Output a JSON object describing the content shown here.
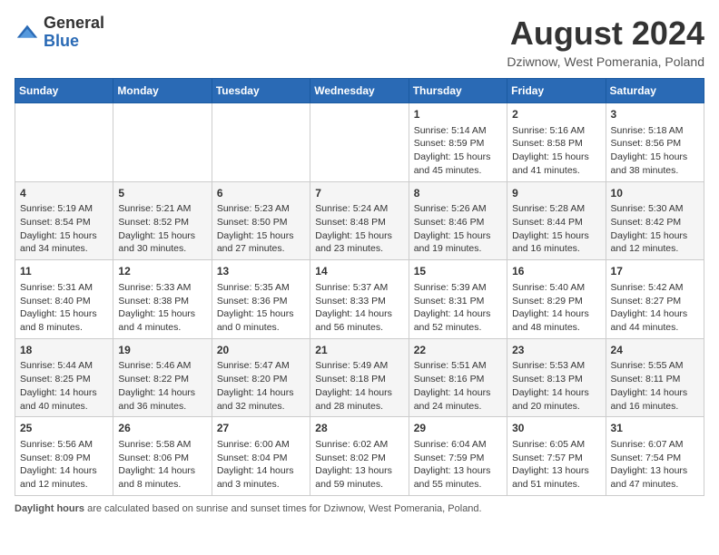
{
  "header": {
    "logo_general": "General",
    "logo_blue": "Blue",
    "month_year": "August 2024",
    "location": "Dziwnow, West Pomerania, Poland"
  },
  "days_of_week": [
    "Sunday",
    "Monday",
    "Tuesday",
    "Wednesday",
    "Thursday",
    "Friday",
    "Saturday"
  ],
  "weeks": [
    [
      {
        "day": "",
        "info": ""
      },
      {
        "day": "",
        "info": ""
      },
      {
        "day": "",
        "info": ""
      },
      {
        "day": "",
        "info": ""
      },
      {
        "day": "1",
        "info": "Sunrise: 5:14 AM\nSunset: 8:59 PM\nDaylight: 15 hours and 45 minutes."
      },
      {
        "day": "2",
        "info": "Sunrise: 5:16 AM\nSunset: 8:58 PM\nDaylight: 15 hours and 41 minutes."
      },
      {
        "day": "3",
        "info": "Sunrise: 5:18 AM\nSunset: 8:56 PM\nDaylight: 15 hours and 38 minutes."
      }
    ],
    [
      {
        "day": "4",
        "info": "Sunrise: 5:19 AM\nSunset: 8:54 PM\nDaylight: 15 hours and 34 minutes."
      },
      {
        "day": "5",
        "info": "Sunrise: 5:21 AM\nSunset: 8:52 PM\nDaylight: 15 hours and 30 minutes."
      },
      {
        "day": "6",
        "info": "Sunrise: 5:23 AM\nSunset: 8:50 PM\nDaylight: 15 hours and 27 minutes."
      },
      {
        "day": "7",
        "info": "Sunrise: 5:24 AM\nSunset: 8:48 PM\nDaylight: 15 hours and 23 minutes."
      },
      {
        "day": "8",
        "info": "Sunrise: 5:26 AM\nSunset: 8:46 PM\nDaylight: 15 hours and 19 minutes."
      },
      {
        "day": "9",
        "info": "Sunrise: 5:28 AM\nSunset: 8:44 PM\nDaylight: 15 hours and 16 minutes."
      },
      {
        "day": "10",
        "info": "Sunrise: 5:30 AM\nSunset: 8:42 PM\nDaylight: 15 hours and 12 minutes."
      }
    ],
    [
      {
        "day": "11",
        "info": "Sunrise: 5:31 AM\nSunset: 8:40 PM\nDaylight: 15 hours and 8 minutes."
      },
      {
        "day": "12",
        "info": "Sunrise: 5:33 AM\nSunset: 8:38 PM\nDaylight: 15 hours and 4 minutes."
      },
      {
        "day": "13",
        "info": "Sunrise: 5:35 AM\nSunset: 8:36 PM\nDaylight: 15 hours and 0 minutes."
      },
      {
        "day": "14",
        "info": "Sunrise: 5:37 AM\nSunset: 8:33 PM\nDaylight: 14 hours and 56 minutes."
      },
      {
        "day": "15",
        "info": "Sunrise: 5:39 AM\nSunset: 8:31 PM\nDaylight: 14 hours and 52 minutes."
      },
      {
        "day": "16",
        "info": "Sunrise: 5:40 AM\nSunset: 8:29 PM\nDaylight: 14 hours and 48 minutes."
      },
      {
        "day": "17",
        "info": "Sunrise: 5:42 AM\nSunset: 8:27 PM\nDaylight: 14 hours and 44 minutes."
      }
    ],
    [
      {
        "day": "18",
        "info": "Sunrise: 5:44 AM\nSunset: 8:25 PM\nDaylight: 14 hours and 40 minutes."
      },
      {
        "day": "19",
        "info": "Sunrise: 5:46 AM\nSunset: 8:22 PM\nDaylight: 14 hours and 36 minutes."
      },
      {
        "day": "20",
        "info": "Sunrise: 5:47 AM\nSunset: 8:20 PM\nDaylight: 14 hours and 32 minutes."
      },
      {
        "day": "21",
        "info": "Sunrise: 5:49 AM\nSunset: 8:18 PM\nDaylight: 14 hours and 28 minutes."
      },
      {
        "day": "22",
        "info": "Sunrise: 5:51 AM\nSunset: 8:16 PM\nDaylight: 14 hours and 24 minutes."
      },
      {
        "day": "23",
        "info": "Sunrise: 5:53 AM\nSunset: 8:13 PM\nDaylight: 14 hours and 20 minutes."
      },
      {
        "day": "24",
        "info": "Sunrise: 5:55 AM\nSunset: 8:11 PM\nDaylight: 14 hours and 16 minutes."
      }
    ],
    [
      {
        "day": "25",
        "info": "Sunrise: 5:56 AM\nSunset: 8:09 PM\nDaylight: 14 hours and 12 minutes."
      },
      {
        "day": "26",
        "info": "Sunrise: 5:58 AM\nSunset: 8:06 PM\nDaylight: 14 hours and 8 minutes."
      },
      {
        "day": "27",
        "info": "Sunrise: 6:00 AM\nSunset: 8:04 PM\nDaylight: 14 hours and 3 minutes."
      },
      {
        "day": "28",
        "info": "Sunrise: 6:02 AM\nSunset: 8:02 PM\nDaylight: 13 hours and 59 minutes."
      },
      {
        "day": "29",
        "info": "Sunrise: 6:04 AM\nSunset: 7:59 PM\nDaylight: 13 hours and 55 minutes."
      },
      {
        "day": "30",
        "info": "Sunrise: 6:05 AM\nSunset: 7:57 PM\nDaylight: 13 hours and 51 minutes."
      },
      {
        "day": "31",
        "info": "Sunrise: 6:07 AM\nSunset: 7:54 PM\nDaylight: 13 hours and 47 minutes."
      }
    ]
  ],
  "footer": {
    "label": "Daylight hours",
    "description": " are calculated based on sunrise and sunset times for Dziwnow, West Pomerania, Poland."
  }
}
